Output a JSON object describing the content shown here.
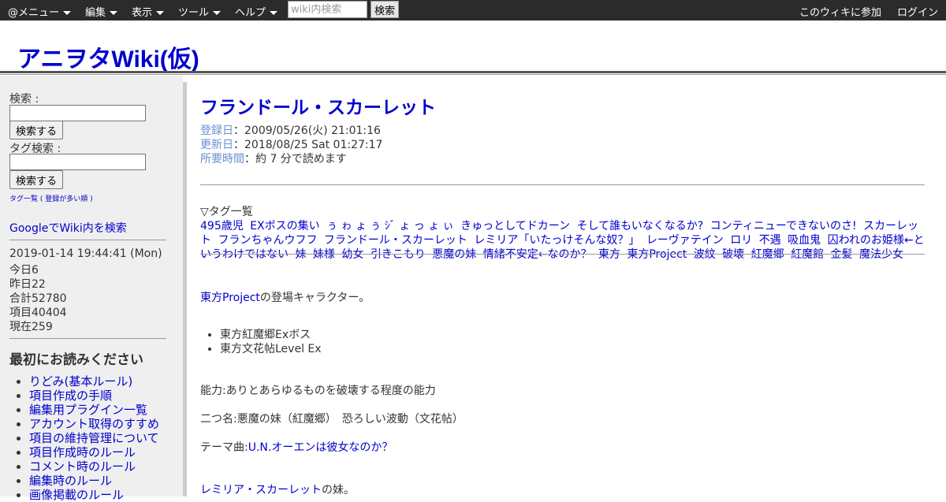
{
  "topbar": {
    "menus": [
      "@メニュー",
      "編集",
      "表示",
      "ツール",
      "ヘルプ"
    ],
    "search_placeholder": "wiki内検索",
    "search_button": "検索",
    "join": "このウィキに参加",
    "login": "ログイン"
  },
  "site": {
    "title": "アニヲタWiki(仮)"
  },
  "sidebar": {
    "search_label": "検索 :",
    "search_button": "検索する",
    "tag_label": "タグ検索 :",
    "tag_button": "検索する",
    "tag_list_link": "タグ一覧",
    "tag_list_paren_open": " ( ",
    "tag_sort_link": "登録が多い順",
    "tag_list_paren_close": " )",
    "google_search": "GoogleでWiki内を検索",
    "stats": {
      "datetime": "2019-01-14 19:44:41 (Mon)",
      "today": "今日6",
      "yesterday": "昨日22",
      "total": "合計52780",
      "items": "項目40404",
      "now": "現在259"
    },
    "read_first_heading": "最初にお読みください",
    "read_first_links": [
      "りどみ(基本ルール)",
      "項目作成の手順",
      "編集用プラグイン一覧",
      "アカウント取得のすすめ",
      "項目の維持管理について",
      "項目作成時のルール",
      "コメント時のルール",
      "編集時のルール",
      "画像掲載のルール"
    ]
  },
  "main": {
    "title": "フランドール・スカーレット",
    "meta": {
      "registered_label": "登録日",
      "registered_value": "：2009/05/26(火) 21:01:16",
      "updated_label": "更新日",
      "updated_value": "：2018/08/25 Sat 01:27:17",
      "time_label": "所要時間",
      "time_value": "：約 7 分で読めます"
    },
    "tags_heading": "▽タグ一覧",
    "tags": [
      "495歳児",
      "EXボスの集い",
      "ぅ ゎ ょ ぅ ｼﾞ ょ っ ょ ぃ",
      "きゅっとしてドカーン",
      "そして誰もいなくなるか?",
      "コンティニューできないのさ!",
      "スカーレット",
      "フランちゃんウフフ",
      "フランドール・スカーレット",
      "レミリア「いたっけそんな奴？」",
      "レーヴァテイン",
      "ロリ",
      "不遇",
      "吸血鬼",
      "囚われのお姫様←というわけではない",
      "妹",
      "妹様",
      "幼女",
      "引きこもり",
      "悪魔の妹",
      "情緒不安定←なのか？",
      "東方",
      "東方Project",
      "波紋",
      "破壊",
      "紅魔郷",
      "紅魔館",
      "金髪",
      "魔法少女"
    ],
    "intro_link": "東方Project",
    "intro_text": "の登場キャラクター。",
    "appearances": [
      "東方紅魔郷Exボス",
      "東方文花帖Level Ex"
    ],
    "ability": "能力:ありとあらゆるものを破壊する程度の能力",
    "nicknames": "二つ名:悪魔の妹（紅魔郷）　恐ろしい波動（文花帖）",
    "theme_prefix": "テーマ曲:",
    "theme_link": "U.N.オーエンは彼女なのか？",
    "sister_link": "レミリア・スカーレット",
    "sister_text": "の妹。"
  }
}
